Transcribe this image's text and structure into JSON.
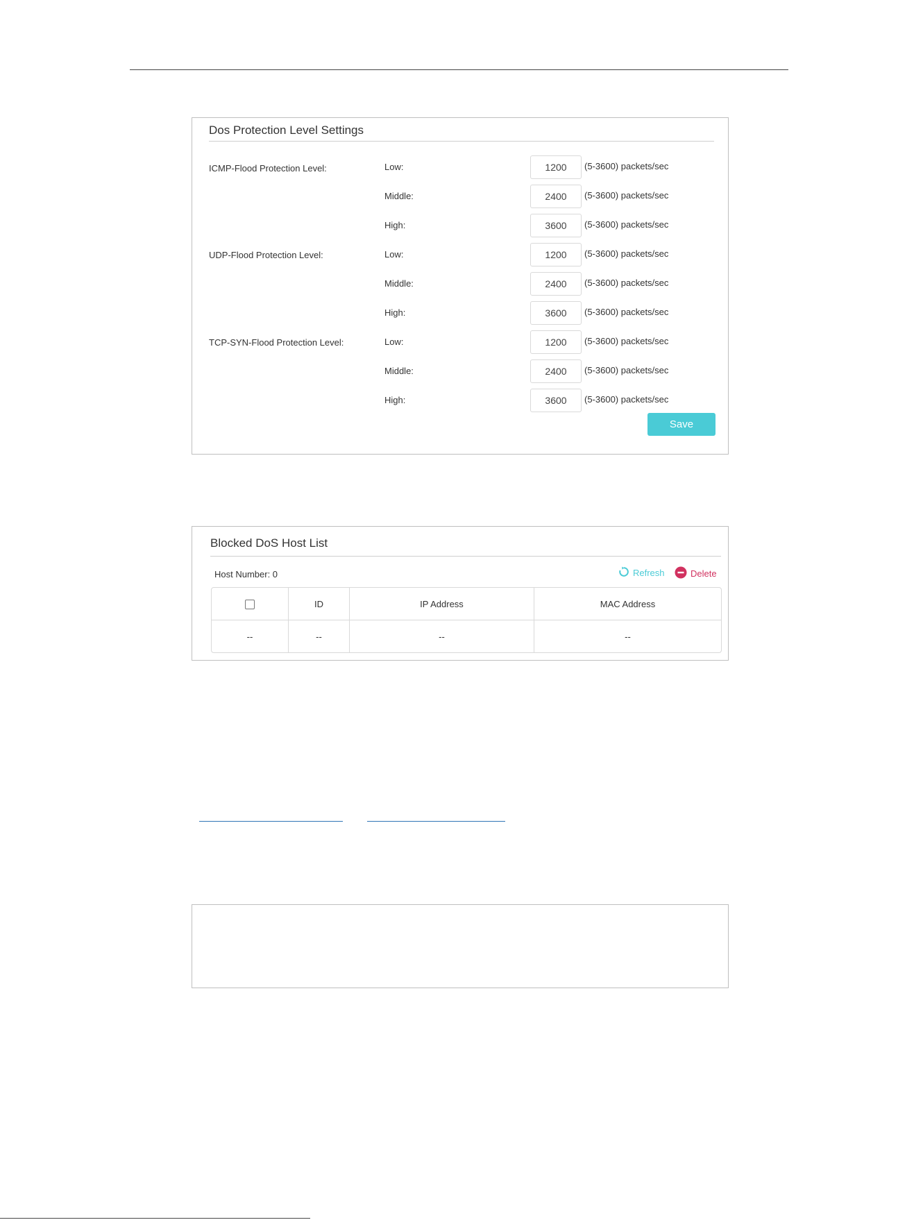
{
  "dos_settings": {
    "title": "Dos Protection Level Settings",
    "groups": [
      {
        "label": "ICMP-Flood Protection Level:",
        "levels": [
          {
            "label": "Low:",
            "value": "1200",
            "hint": "(5-3600) packets/sec"
          },
          {
            "label": "Middle:",
            "value": "2400",
            "hint": "(5-3600) packets/sec"
          },
          {
            "label": "High:",
            "value": "3600",
            "hint": "(5-3600) packets/sec"
          }
        ]
      },
      {
        "label": "UDP-Flood Protection Level:",
        "levels": [
          {
            "label": "Low:",
            "value": "1200",
            "hint": "(5-3600) packets/sec"
          },
          {
            "label": "Middle:",
            "value": "2400",
            "hint": "(5-3600) packets/sec"
          },
          {
            "label": "High:",
            "value": "3600",
            "hint": "(5-3600) packets/sec"
          }
        ]
      },
      {
        "label": "TCP-SYN-Flood Protection Level:",
        "levels": [
          {
            "label": "Low:",
            "value": "1200",
            "hint": "(5-3600) packets/sec"
          },
          {
            "label": "Middle:",
            "value": "2400",
            "hint": "(5-3600) packets/sec"
          },
          {
            "label": "High:",
            "value": "3600",
            "hint": "(5-3600) packets/sec"
          }
        ]
      }
    ],
    "save_label": "Save"
  },
  "blocked_hosts": {
    "title": "Blocked DoS Host List",
    "host_number": "Host Number: 0",
    "refresh_label": "Refresh",
    "delete_label": "Delete",
    "columns": [
      "",
      "ID",
      "IP Address",
      "MAC Address"
    ],
    "rows": [
      [
        "--",
        "--",
        "--",
        "--"
      ]
    ]
  },
  "colors": {
    "accent": "#4acbd6",
    "delete": "#d1315f",
    "link": "#2e74b5"
  }
}
